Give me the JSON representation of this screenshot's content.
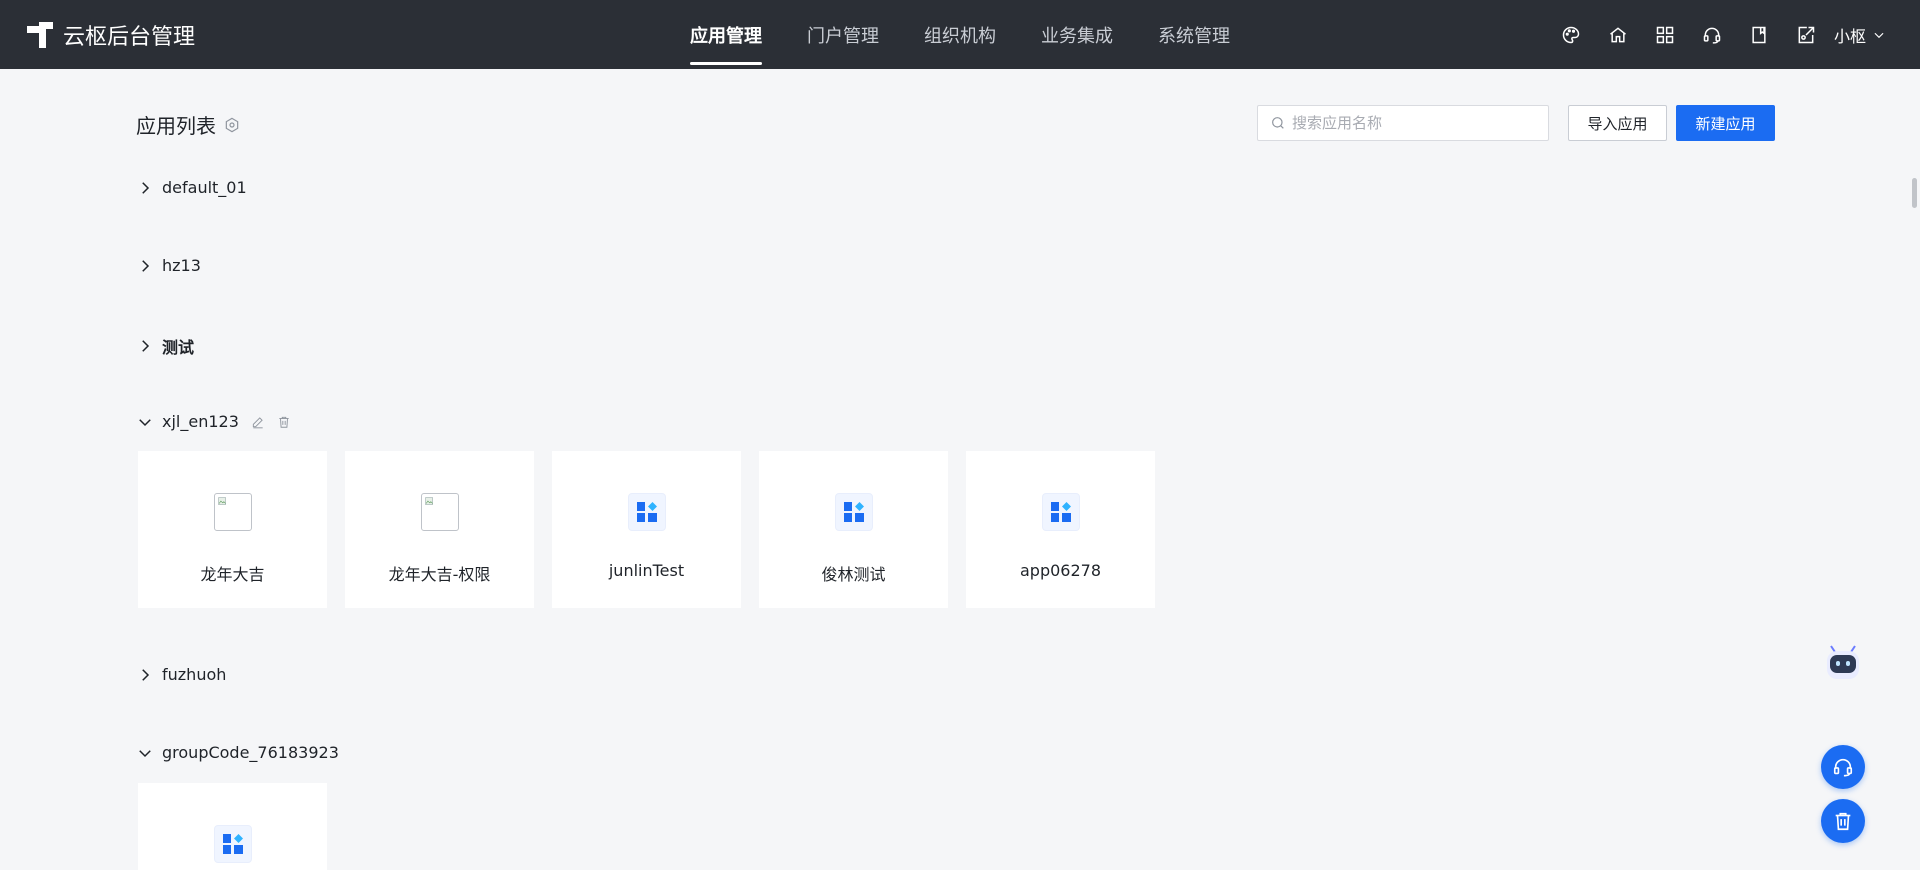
{
  "brand": {
    "title": "云枢后台管理"
  },
  "nav": {
    "items": [
      {
        "label": "应用管理",
        "active": true
      },
      {
        "label": "门户管理"
      },
      {
        "label": "组织机构"
      },
      {
        "label": "业务集成"
      },
      {
        "label": "系统管理"
      }
    ]
  },
  "toolbar": {
    "icons": [
      "palette-icon",
      "home-icon",
      "apps-grid-icon",
      "headset-icon",
      "book-icon",
      "export-icon"
    ],
    "user_name": "小枢"
  },
  "page": {
    "title": "应用列表",
    "search_placeholder": "搜索应用名称",
    "import_label": "导入应用",
    "create_label": "新建应用"
  },
  "groups": [
    {
      "name": "default_01",
      "expanded": false
    },
    {
      "name": "hz13",
      "expanded": false
    },
    {
      "name": "测试",
      "expanded": false
    },
    {
      "name": "xjl_en123",
      "expanded": true,
      "apps": [
        {
          "name": "龙年大吉",
          "icon": "broken-image"
        },
        {
          "name": "龙年大吉-权限",
          "icon": "broken-image"
        },
        {
          "name": "junlinTest",
          "icon": "app-tile-icon"
        },
        {
          "name": "俊林测试",
          "icon": "app-tile-icon"
        },
        {
          "name": "app06278",
          "icon": "app-tile-icon"
        }
      ]
    },
    {
      "name": "fuzhuoh",
      "expanded": false
    },
    {
      "name": "groupCode_76183923",
      "expanded": true,
      "apps": [
        {
          "name": "",
          "icon": "app-tile-icon"
        }
      ]
    }
  ],
  "colors": {
    "primary": "#1b6cf2",
    "topbar": "#2b2f36",
    "background": "#f5f6f8"
  }
}
